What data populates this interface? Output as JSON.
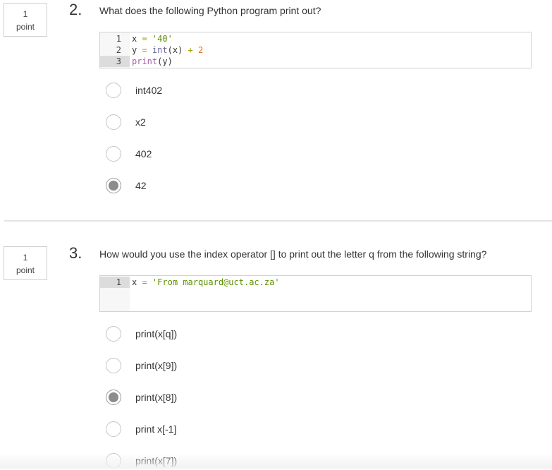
{
  "questions": [
    {
      "points_value": "1",
      "points_label": "point",
      "number": "2.",
      "text": "What does the following Python program print out?",
      "code_lines": [
        {
          "n": "1",
          "parts": [
            [
              "x",
              "var"
            ],
            [
              " = ",
              "op"
            ],
            [
              "'40'",
              "str"
            ]
          ]
        },
        {
          "n": "2",
          "parts": [
            [
              "y",
              "var"
            ],
            [
              " = ",
              "op"
            ],
            [
              "int",
              "fn"
            ],
            [
              "(x) ",
              "p"
            ],
            [
              "+ ",
              "op"
            ],
            [
              "2",
              "num"
            ]
          ]
        },
        {
          "n": "3",
          "parts": [
            [
              "print",
              "kw"
            ],
            [
              "(y)",
              "p"
            ]
          ]
        }
      ],
      "options": [
        {
          "label": "int402",
          "selected": false
        },
        {
          "label": "x2",
          "selected": false
        },
        {
          "label": "402",
          "selected": false
        },
        {
          "label": "42",
          "selected": true
        }
      ]
    },
    {
      "points_value": "1",
      "points_label": "point",
      "number": "3.",
      "text": "How would you use the index operator [] to print out the letter q from the following string?",
      "code_lines": [
        {
          "n": "1",
          "parts": [
            [
              "x",
              "var"
            ],
            [
              " = ",
              "op"
            ],
            [
              "'From marquard@uct.ac.za'",
              "str"
            ]
          ]
        }
      ],
      "options": [
        {
          "label": "print(x[q])",
          "selected": false
        },
        {
          "label": "print(x[9])",
          "selected": false
        },
        {
          "label": "print(x[8])",
          "selected": true
        },
        {
          "label": "print x[-1]",
          "selected": false
        },
        {
          "label": "print(x[7])",
          "selected": false
        }
      ]
    }
  ]
}
